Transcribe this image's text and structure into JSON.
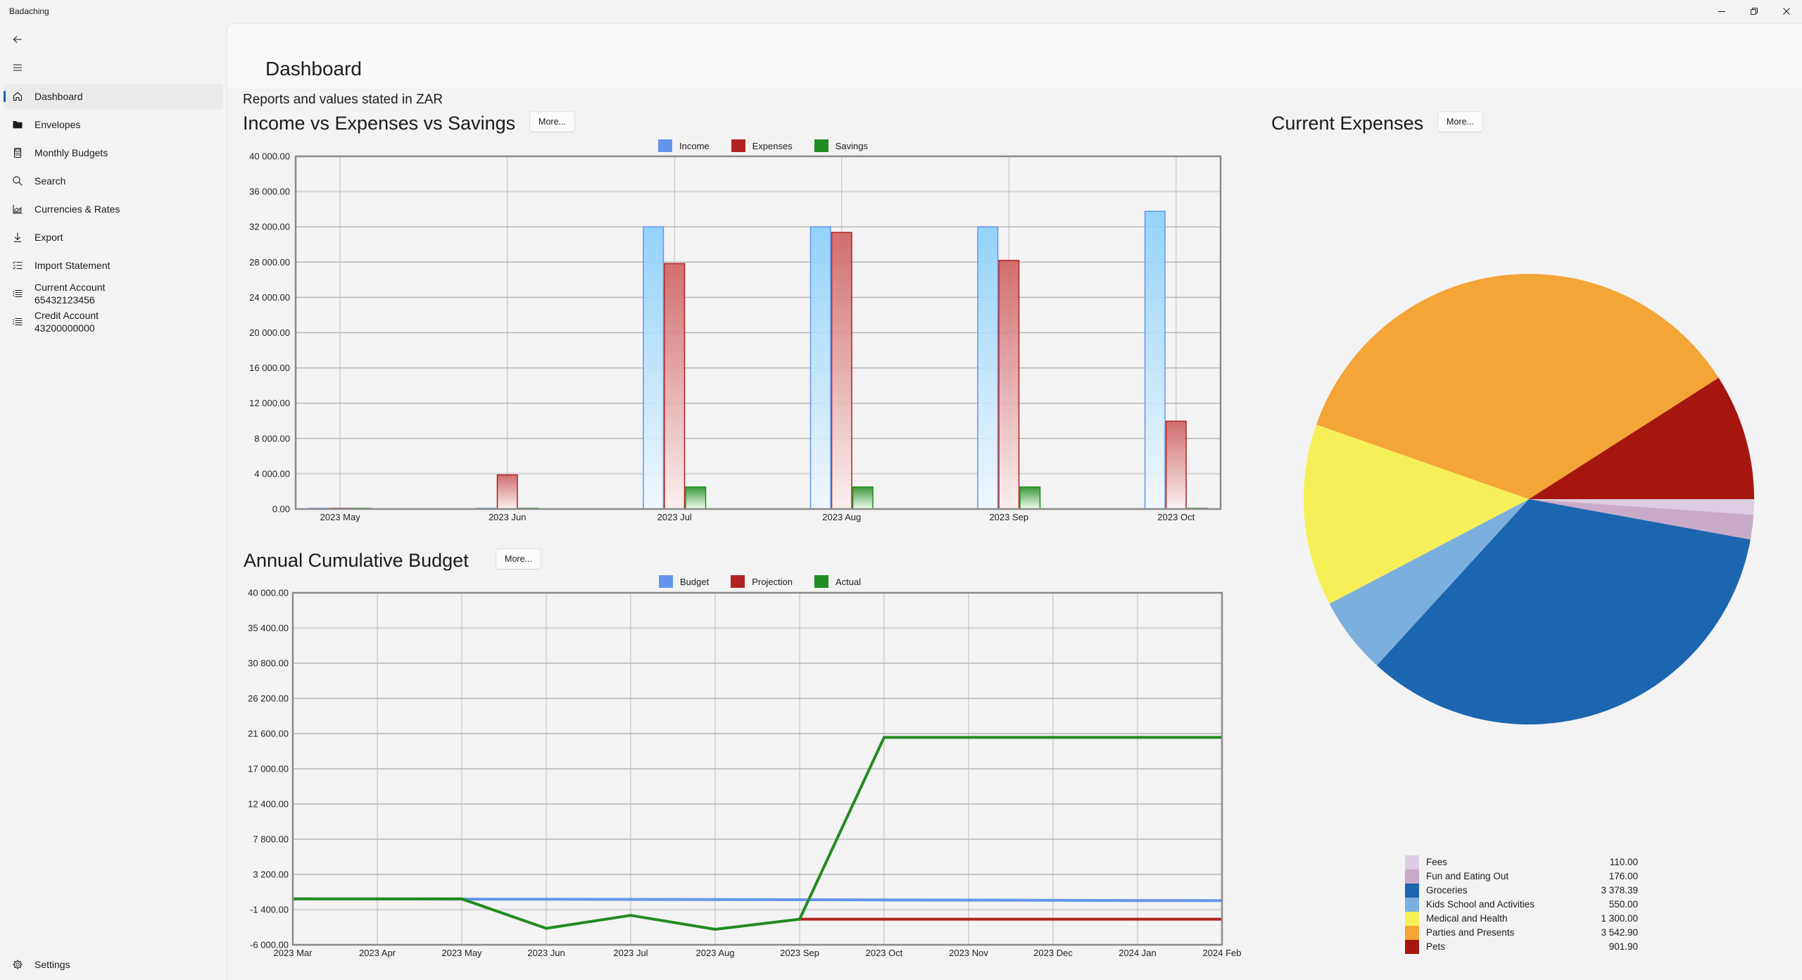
{
  "window": {
    "title": "Badaching",
    "controls": [
      "minimize",
      "restore",
      "close"
    ]
  },
  "sidebar": {
    "items": [
      {
        "label": "Dashboard",
        "icon": "home-icon",
        "selected": true
      },
      {
        "label": "Envelopes",
        "icon": "folder-icon"
      },
      {
        "label": "Monthly Budgets",
        "icon": "calculator-icon"
      },
      {
        "label": "Search",
        "icon": "search-icon"
      },
      {
        "label": "Currencies & Rates",
        "icon": "area-chart-icon"
      },
      {
        "label": "Export",
        "icon": "download-icon"
      },
      {
        "label": "Import Statement",
        "icon": "checklist-icon"
      },
      {
        "label": "Current Account",
        "sublabel": "65432123456",
        "icon": "list-icon"
      },
      {
        "label": "Credit Account",
        "sublabel": "43200000000",
        "icon": "list-icon"
      }
    ],
    "footer": {
      "label": "Settings",
      "icon": "gear-icon"
    }
  },
  "header": {
    "title": "Dashboard"
  },
  "main": {
    "currency_note": "Reports and values stated in ZAR"
  },
  "chart_data": [
    {
      "type": "bar",
      "title": "Income vs Expenses vs Savings",
      "more_label": "More...",
      "categories": [
        "2023 May",
        "2023 Jun",
        "2023 Jul",
        "2023 Aug",
        "2023 Sep",
        "2023 Oct"
      ],
      "series": [
        {
          "name": "Income",
          "color": "#6495ed",
          "values": [
            0,
            0,
            32000,
            32000,
            32000,
            33760
          ]
        },
        {
          "name": "Expenses",
          "color": "#b22222",
          "values": [
            0,
            3870,
            27830,
            31360,
            28190,
            9959.19
          ]
        },
        {
          "name": "Savings",
          "color": "#228b22",
          "values": [
            0,
            0,
            2500,
            2500,
            2500,
            0
          ]
        }
      ],
      "xlabel": "",
      "ylabel": "",
      "ylim": [
        0,
        40000
      ],
      "yticks": [
        0,
        4000,
        8000,
        12000,
        16000,
        20000,
        24000,
        28000,
        32000,
        36000,
        40000
      ],
      "ytick_labels": [
        "0.00",
        "4 000.00",
        "8 000.00",
        "12 000.00",
        "16 000.00",
        "20 000.00",
        "24 000.00",
        "28 000.00",
        "32 000.00",
        "36 000.00",
        "40 000.00"
      ],
      "grid": true,
      "legend": "top-center"
    },
    {
      "type": "line",
      "title": "Annual Cumulative Budget",
      "more_label": "More...",
      "x": [
        "2023 Mar",
        "2023 Apr",
        "2023 May",
        "2023 Jun",
        "2023 Jul",
        "2023 Aug",
        "2023 Sep",
        "2023 Oct",
        "2023 Nov",
        "2023 Dec",
        "2024 Jan",
        "2024 Feb"
      ],
      "series": [
        {
          "name": "Budget",
          "color": "#6495ed",
          "values": [
            0,
            -10,
            -25,
            -45,
            -65,
            -90,
            -110,
            -135,
            -160,
            -185,
            -210,
            -235
          ]
        },
        {
          "name": "Projection",
          "color": "#b22222",
          "values": [
            null,
            null,
            null,
            null,
            null,
            null,
            -2650,
            -2650,
            -2650,
            -2650,
            -2650,
            -2650
          ]
        },
        {
          "name": "Actual",
          "color": "#228b22",
          "values": [
            0,
            0,
            0,
            -3850,
            -2150,
            -3980,
            -2650,
            21100,
            21100,
            21100,
            21100,
            21100
          ]
        }
      ],
      "xlabel": "",
      "ylabel": "",
      "ylim": [
        -6000,
        40000
      ],
      "yticks": [
        -6000,
        -1400,
        3200,
        7800,
        12400,
        17000,
        21600,
        26200,
        30800,
        35400,
        40000
      ],
      "ytick_labels": [
        "-6 000.00",
        "-1 400.00",
        "3 200.00",
        "7 800.00",
        "12 400.00",
        "17 000.00",
        "21 600.00",
        "26 200.00",
        "30 800.00",
        "35 400.00",
        "40 000.00"
      ],
      "grid": true,
      "legend": "top-center"
    },
    {
      "type": "pie",
      "title": "Current Expenses",
      "more_label": "More...",
      "slices": [
        {
          "label": "Fees",
          "value": 110.0,
          "value_label": "110.00",
          "color": "#dccde3"
        },
        {
          "label": "Fun and Eating Out",
          "value": 176.0,
          "value_label": "176.00",
          "color": "#c9abc9"
        },
        {
          "label": "Groceries",
          "value": 3378.39,
          "value_label": "3 378.39",
          "color": "#1c66b0"
        },
        {
          "label": "Kids School and Activities",
          "value": 550.0,
          "value_label": "550.00",
          "color": "#7bafdd"
        },
        {
          "label": "Medical and Health",
          "value": 1300.0,
          "value_label": "1 300.00",
          "color": "#f7ef58"
        },
        {
          "label": "Parties and Presents",
          "value": 3542.9,
          "value_label": "3 542.90",
          "color": "#f3a538"
        },
        {
          "label": "Pets",
          "value": 901.9,
          "value_label": "901.90",
          "color": "#a5160f"
        }
      ],
      "legend": "bottom"
    }
  ]
}
